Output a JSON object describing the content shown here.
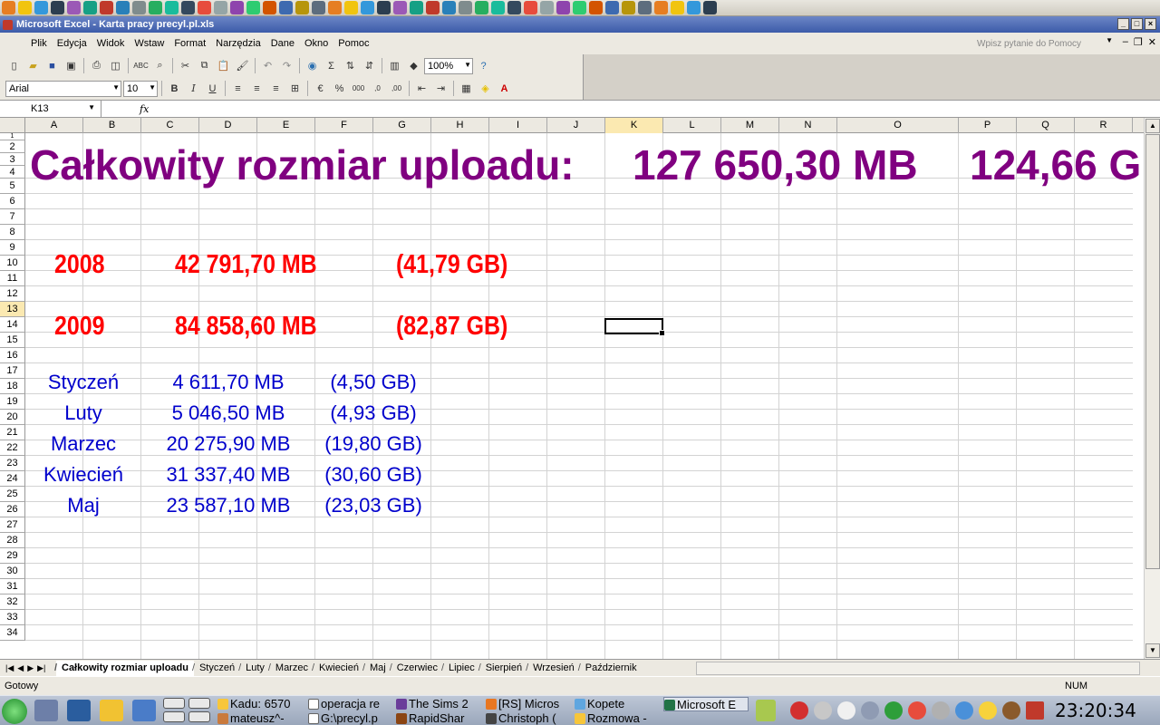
{
  "window": {
    "title": "Microsoft Excel - Karta pracy precyl.pl.xls"
  },
  "menu": {
    "items": [
      "Plik",
      "Edycja",
      "Widok",
      "Wstaw",
      "Format",
      "Narzędzia",
      "Dane",
      "Okno",
      "Pomoc"
    ],
    "help_placeholder": "Wpisz pytanie do Pomocy"
  },
  "toolbar": {
    "zoom": "100%",
    "font": "Arial",
    "size": "10"
  },
  "formula": {
    "cell_ref": "K13",
    "fx": "fx"
  },
  "columns": [
    "A",
    "B",
    "C",
    "D",
    "E",
    "F",
    "G",
    "H",
    "I",
    "J",
    "K",
    "L",
    "M",
    "N",
    "O",
    "P",
    "Q",
    "R"
  ],
  "rows": [
    "1",
    "2",
    "3",
    "4",
    "5",
    "6",
    "7",
    "8",
    "9",
    "10",
    "11",
    "12",
    "13",
    "14",
    "15",
    "16",
    "17",
    "18",
    "19",
    "20",
    "21",
    "22",
    "23",
    "24",
    "25",
    "26",
    "27",
    "28",
    "29",
    "30",
    "31",
    "32",
    "33",
    "34"
  ],
  "sheet": {
    "title_label": "Całkowity rozmiar uploadu:",
    "total_mb": "127 650,30 MB",
    "total_gb": "124,66 G",
    "years": [
      {
        "year": "2008",
        "mb": "42 791,70 MB",
        "gb": "(41,79 GB)"
      },
      {
        "year": "2009",
        "mb": "84 858,60 MB",
        "gb": "(82,87 GB)"
      }
    ],
    "months": [
      {
        "name": "Styczeń",
        "mb": "4 611,70 MB",
        "gb": "(4,50 GB)"
      },
      {
        "name": "Luty",
        "mb": "5 046,50 MB",
        "gb": "(4,93 GB)"
      },
      {
        "name": "Marzec",
        "mb": "20 275,90 MB",
        "gb": "(19,80 GB)"
      },
      {
        "name": "Kwiecień",
        "mb": "31 337,40 MB",
        "gb": "(30,60 GB)"
      },
      {
        "name": "Maj",
        "mb": "23 587,10 MB",
        "gb": "(23,03 GB)"
      }
    ]
  },
  "sheet_tabs": [
    "Całkowity rozmiar uploadu",
    "Styczeń",
    "Luty",
    "Marzec",
    "Kwiecień",
    "Maj",
    "Czerwiec",
    "Lipiec",
    "Sierpień",
    "Wrzesień",
    "Październik"
  ],
  "status": {
    "left": "Gotowy",
    "num": "NUM"
  },
  "taskbar": {
    "tasks": [
      "Kadu: 6570",
      "mateusz^-",
      "operacja re",
      "G:\\precyl.p",
      "The Sims 2",
      "RapidShar",
      "[RS] Micros",
      "Christoph (",
      "Kopete",
      "Rozmowa -",
      "Microsoft E"
    ],
    "clock": "23:20:34"
  },
  "colors": {
    "title": "#800080",
    "years": "#ff0000",
    "months": "#0000cc"
  }
}
